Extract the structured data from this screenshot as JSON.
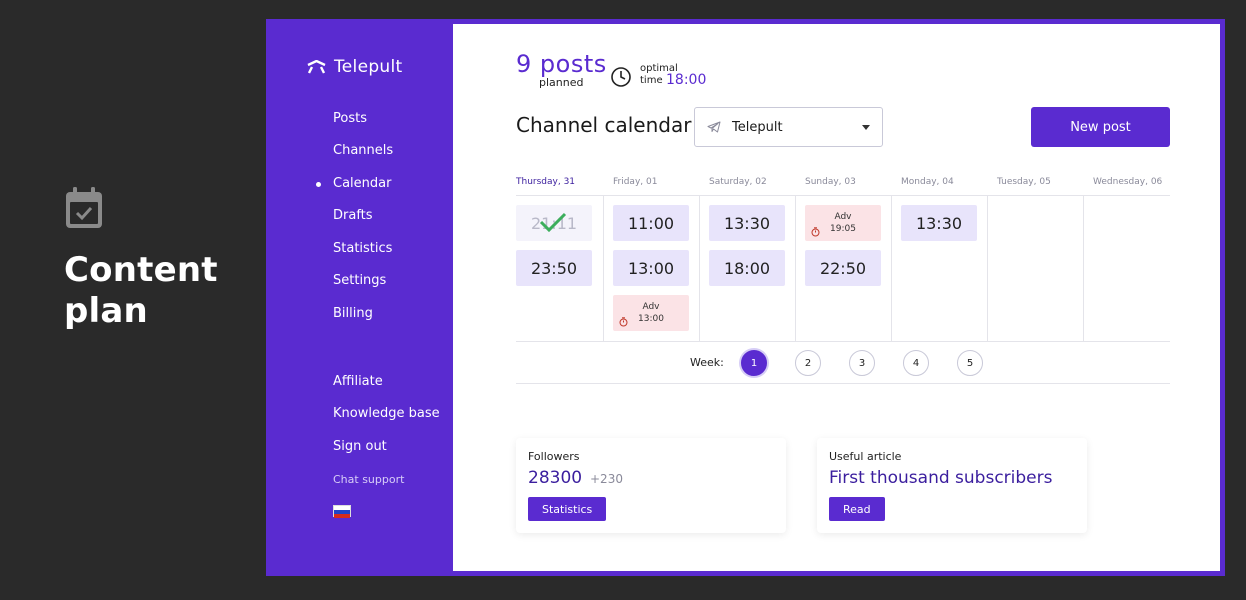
{
  "promo": {
    "title_line1": "Content",
    "title_line2": "plan",
    "icon": "calendar-check-icon"
  },
  "sidebar": {
    "logo_text": "Telepult",
    "nav": [
      {
        "label": "Posts"
      },
      {
        "label": "Channels"
      },
      {
        "label": "Calendar",
        "active": true
      },
      {
        "label": "Drafts"
      },
      {
        "label": "Statistics"
      },
      {
        "label": "Settings"
      },
      {
        "label": "Billing"
      }
    ],
    "secondary": [
      {
        "label": "Affiliate"
      },
      {
        "label": "Knowledge base"
      },
      {
        "label": "Sign out"
      }
    ],
    "chat_support": "Chat support",
    "flag": "russia-flag"
  },
  "header": {
    "posts_count": "9 posts",
    "posts_sub": "planned",
    "optimal_label_1": "optimal",
    "optimal_label_2": "time",
    "optimal_time": "18:00"
  },
  "calendar": {
    "title": "Channel calendar",
    "channel": "Telepult",
    "new_post": "New post",
    "days": [
      {
        "name": "Thursday, 31",
        "active": true,
        "slots": [
          {
            "time": "21:11",
            "done": true
          },
          {
            "time": "23:50"
          }
        ]
      },
      {
        "name": "Friday, 01",
        "slots": [
          {
            "time": "11:00"
          },
          {
            "time": "13:00"
          },
          {
            "adv": "Adv",
            "time": "13:00"
          }
        ]
      },
      {
        "name": "Saturday, 02",
        "slots": [
          {
            "time": "13:30"
          },
          {
            "time": "18:00"
          }
        ]
      },
      {
        "name": "Sunday, 03",
        "slots": [
          {
            "adv": "Adv",
            "time": "19:05"
          },
          {
            "time": "22:50"
          }
        ]
      },
      {
        "name": "Monday, 04",
        "slots": [
          {
            "time": "13:30"
          }
        ]
      },
      {
        "name": "Tuesday, 05",
        "slots": []
      },
      {
        "name": "Wednesday, 06",
        "slots": []
      }
    ],
    "week_label": "Week:",
    "weeks": [
      "1",
      "2",
      "3",
      "4",
      "5"
    ],
    "active_week": "1"
  },
  "cards": {
    "followers": {
      "label": "Followers",
      "count": "28300",
      "delta": "+230",
      "button": "Statistics"
    },
    "article": {
      "label": "Useful article",
      "title": "First thousand subscribers",
      "button": "Read"
    }
  },
  "colors": {
    "accent": "#5a2bd0",
    "slot": "#e8e4fb",
    "adv": "#fbe3e6",
    "check": "#3cae5c"
  }
}
